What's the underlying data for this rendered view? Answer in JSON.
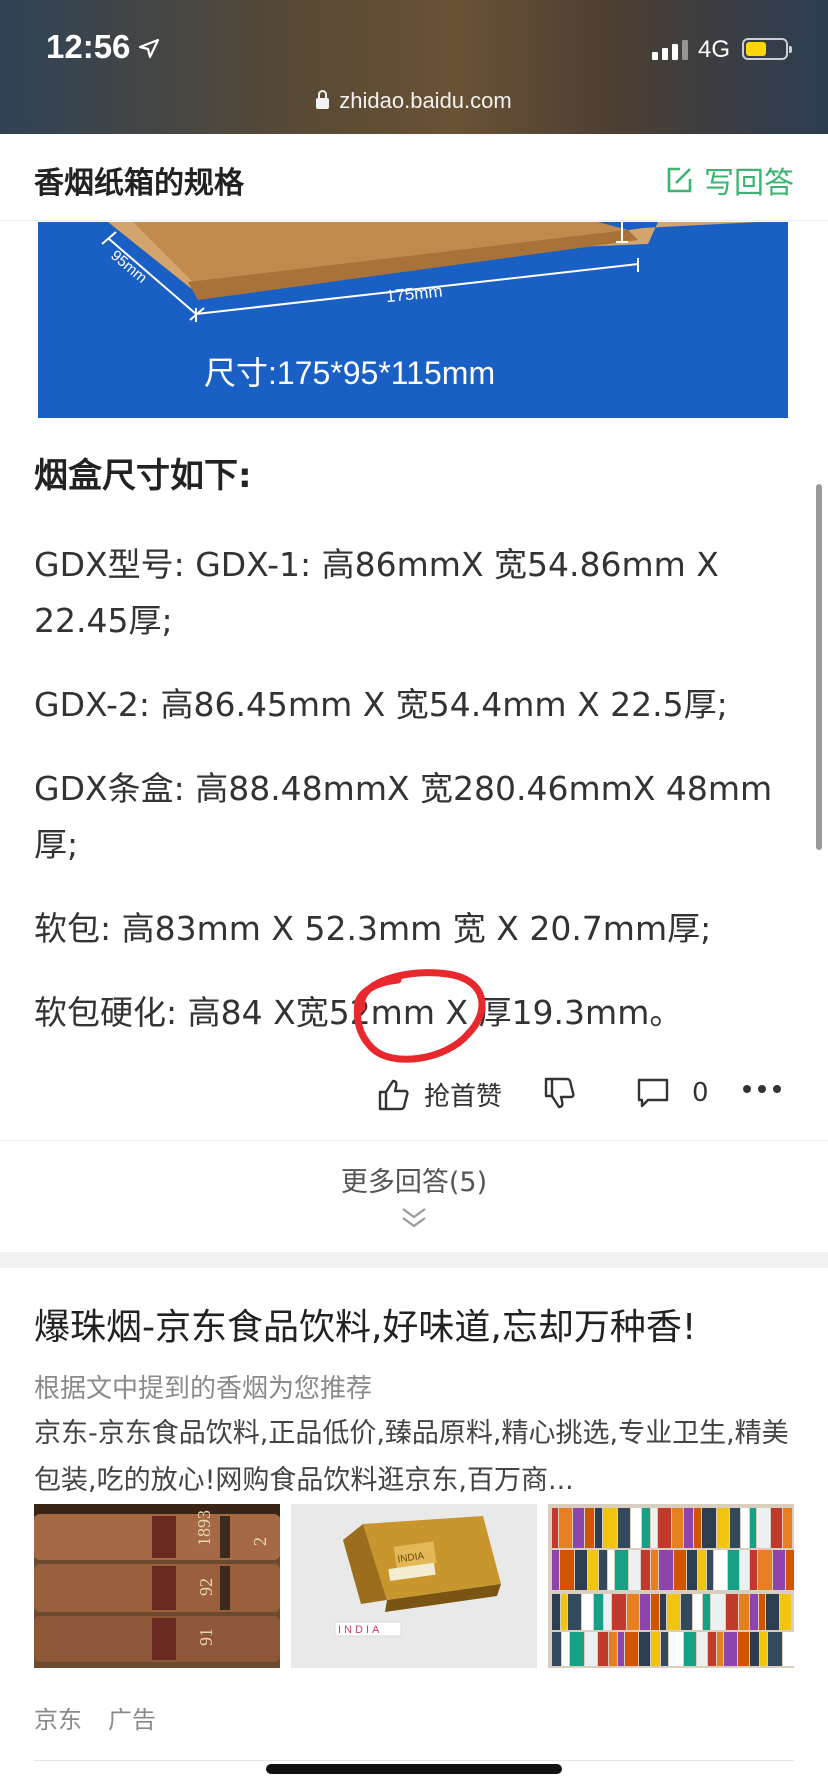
{
  "status_bar": {
    "time": "12:56",
    "network": "4G",
    "battery_level": 0.5
  },
  "browser": {
    "url": "zhidao.baidu.com"
  },
  "header": {
    "title": "香烟纸箱的规格",
    "answer_button": "写回答"
  },
  "product_image": {
    "size_text": "尺寸:175*95*115mm",
    "dim_length": "175mm",
    "dim_width": "95mm"
  },
  "answer": {
    "heading": "烟盒尺寸如下:",
    "paragraphs": [
      "GDX型号: GDX-1: 高86mmX 宽54.86mm X 22.45厚;",
      "GDX-2: 高86.45mm X 宽54.4mm X 22.5厚;",
      "GDX条盒: 高88.48mmX 宽280.46mmX 48mm厚;",
      "软包: 高83mm X 52.3mm 宽 X 20.7mm厚;",
      "软包硬化: 高84 X宽52mm X 厚19.3mm。"
    ]
  },
  "actions": {
    "like_label": "抢首赞",
    "comment_count": "0"
  },
  "more_answers": "更多回答(5)",
  "ad": {
    "title": "爆珠烟-京东食品饮料,好味道,忘却万种香!",
    "reason": "根据文中提到的香烟为您推荐",
    "description": "京东-京东食品饮料,正品低价,臻品原料,精心挑选,专业卫生,精美包装,吃的放心!网购食品饮料逛京东,百万商...",
    "images": [
      {
        "alt": "old-books-image",
        "spine_texts": [
          "1893",
          "92",
          "91",
          "2"
        ]
      },
      {
        "alt": "gold-bar-image",
        "bar_text": "INDIA",
        "block_text": "INDIA"
      },
      {
        "alt": "bookshelf-image"
      }
    ],
    "source": "京东",
    "tag": "广告"
  },
  "colors": {
    "accent_green": "#3cb371",
    "image_blue": "#1a5fc4",
    "annotation_red": "#e8282d"
  }
}
